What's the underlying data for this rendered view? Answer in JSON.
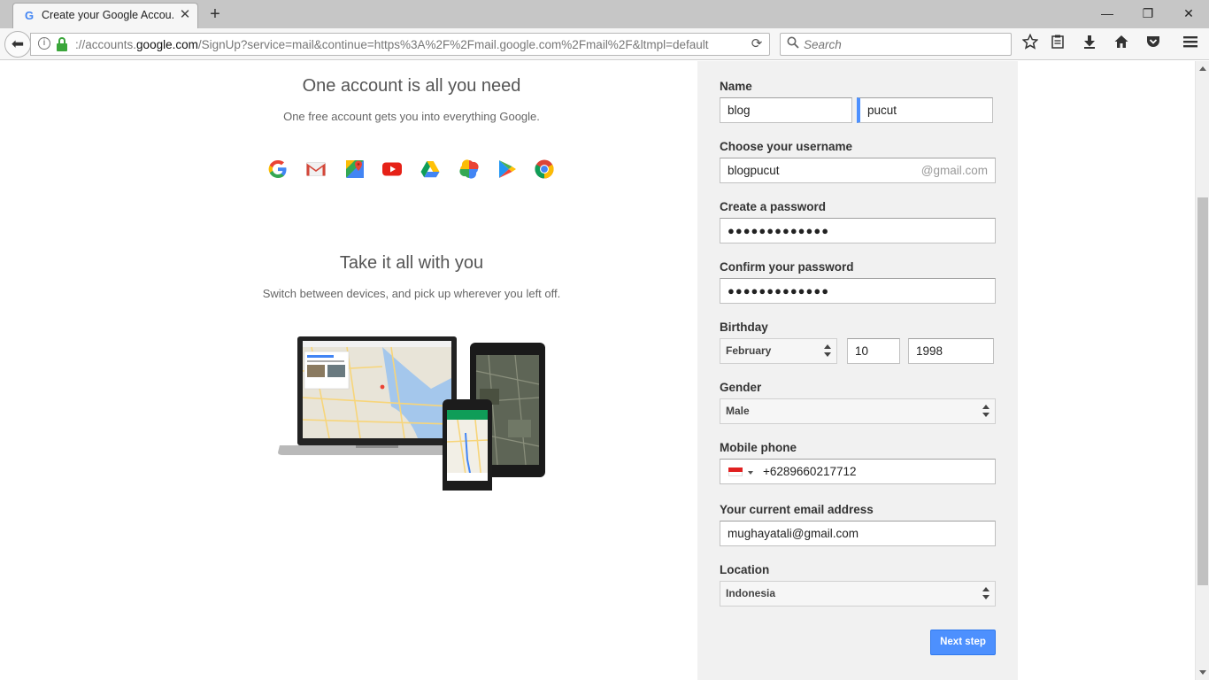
{
  "browser": {
    "tab_title": "Create your Google Accou...",
    "tab_favicon": "G",
    "tab_close": "✕",
    "new_tab": "+",
    "window_controls": {
      "minimize": "—",
      "restore": "❐",
      "close": "✕"
    },
    "url_prefix": "://accounts.",
    "url_domain": "google.com",
    "url_path": "/SignUp?service=mail&continue=https%3A%2F%2Fmail.google.com%2Fmail%2F&ltmpl=default",
    "search_placeholder": "Search",
    "toolbar_icons": [
      "star-icon",
      "reading-list-icon",
      "download-icon",
      "home-icon",
      "pocket-icon",
      "menu-icon"
    ]
  },
  "left": {
    "heading1": "One account is all you need",
    "sub1": "One free account gets you into everything Google.",
    "heading2": "Take it all with you",
    "sub2": "Switch between devices, and pick up wherever you left off.",
    "apps": [
      "google-icon",
      "gmail-icon",
      "maps-icon",
      "youtube-icon",
      "drive-icon",
      "photos-icon",
      "play-icon",
      "chrome-icon"
    ]
  },
  "form": {
    "name_label": "Name",
    "first_name": "blog",
    "last_name": "pucut",
    "username_label": "Choose your username",
    "username": "blogpucut",
    "username_suffix": "@gmail.com",
    "password_label": "Create a password",
    "password_mask": "●●●●●●●●●●●●●",
    "confirm_label": "Confirm your password",
    "confirm_mask": "●●●●●●●●●●●●●",
    "birthday_label": "Birthday",
    "birth_month": "February",
    "birth_day": "10",
    "birth_year": "1998",
    "gender_label": "Gender",
    "gender": "Male",
    "phone_label": "Mobile phone",
    "phone": "+6289660217712",
    "email_label": "Your current email address",
    "email": "mughayatali@gmail.com",
    "location_label": "Location",
    "location": "Indonesia",
    "next_button": "Next step"
  },
  "colors": {
    "accent": "#4d90fe",
    "form_bg": "#f1f1f1",
    "secure_lock": "#3aa63a"
  }
}
